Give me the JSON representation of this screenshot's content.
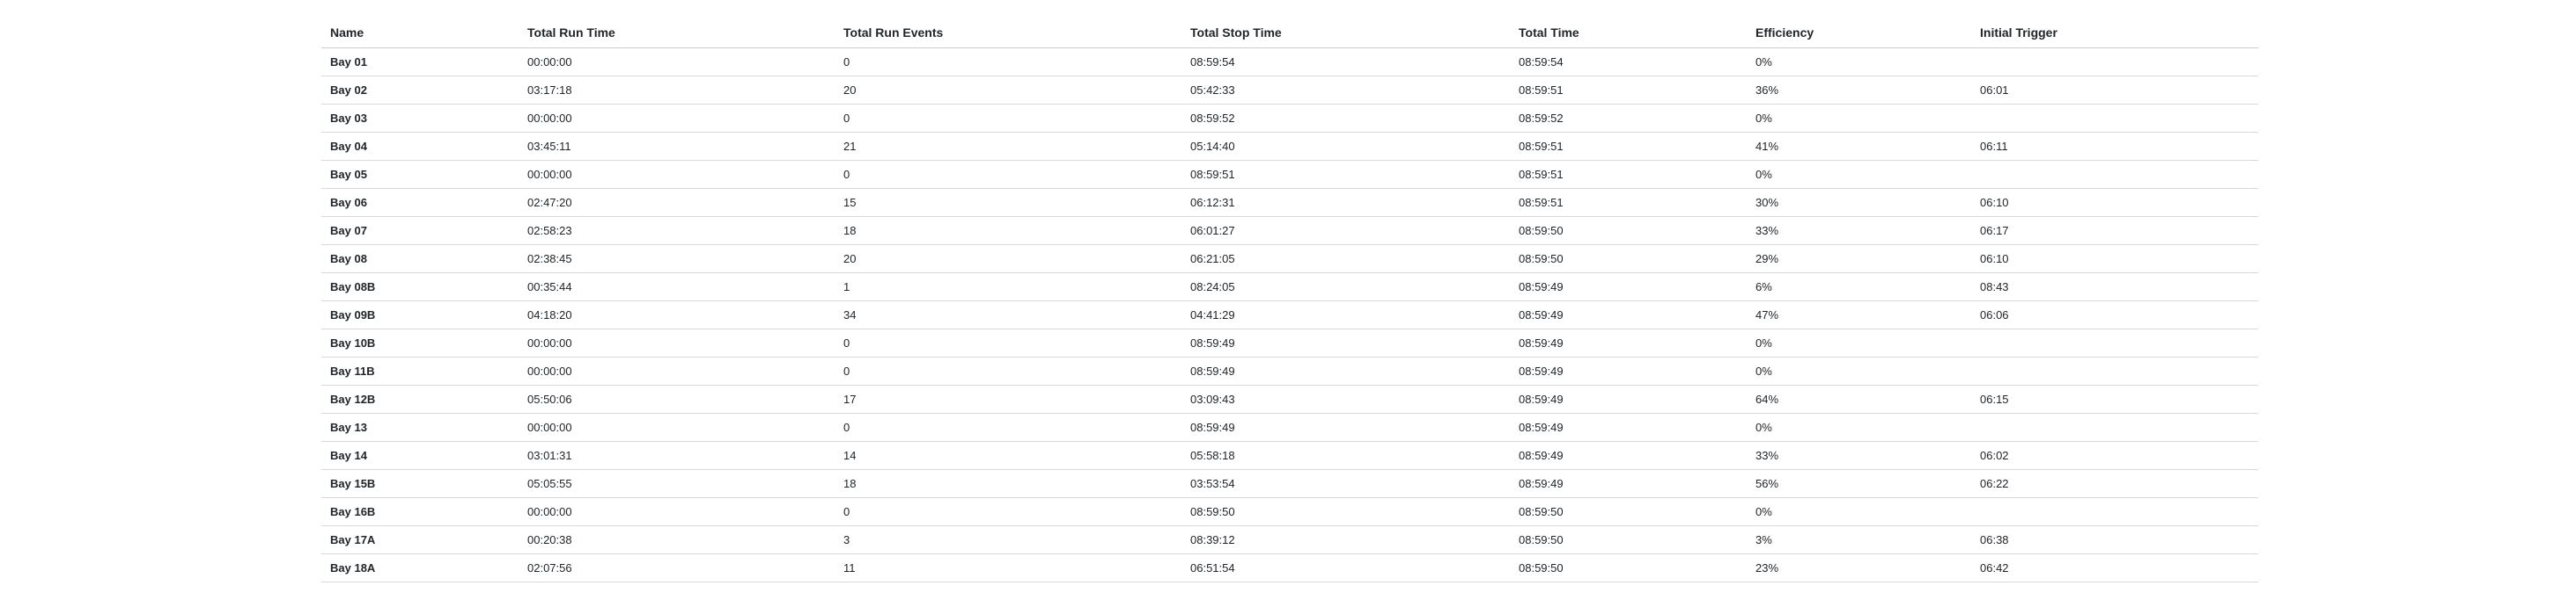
{
  "table": {
    "headers": {
      "name": "Name",
      "total_run_time": "Total Run Time",
      "total_run_events": "Total Run Events",
      "total_stop_time": "Total Stop Time",
      "total_time": "Total Time",
      "efficiency": "Efficiency",
      "initial_trigger": "Initial Trigger"
    },
    "rows": [
      {
        "name": "Bay 01",
        "run_time": "00:00:00",
        "run_events": "0",
        "stop_time": "08:59:54",
        "total_time": "08:59:54",
        "efficiency": "0%",
        "initial_trigger": ""
      },
      {
        "name": "Bay 02",
        "run_time": "03:17:18",
        "run_events": "20",
        "stop_time": "05:42:33",
        "total_time": "08:59:51",
        "efficiency": "36%",
        "initial_trigger": "06:01"
      },
      {
        "name": "Bay 03",
        "run_time": "00:00:00",
        "run_events": "0",
        "stop_time": "08:59:52",
        "total_time": "08:59:52",
        "efficiency": "0%",
        "initial_trigger": ""
      },
      {
        "name": "Bay 04",
        "run_time": "03:45:11",
        "run_events": "21",
        "stop_time": "05:14:40",
        "total_time": "08:59:51",
        "efficiency": "41%",
        "initial_trigger": "06:11"
      },
      {
        "name": "Bay 05",
        "run_time": "00:00:00",
        "run_events": "0",
        "stop_time": "08:59:51",
        "total_time": "08:59:51",
        "efficiency": "0%",
        "initial_trigger": ""
      },
      {
        "name": "Bay 06",
        "run_time": "02:47:20",
        "run_events": "15",
        "stop_time": "06:12:31",
        "total_time": "08:59:51",
        "efficiency": "30%",
        "initial_trigger": "06:10"
      },
      {
        "name": "Bay 07",
        "run_time": "02:58:23",
        "run_events": "18",
        "stop_time": "06:01:27",
        "total_time": "08:59:50",
        "efficiency": "33%",
        "initial_trigger": "06:17"
      },
      {
        "name": "Bay 08",
        "run_time": "02:38:45",
        "run_events": "20",
        "stop_time": "06:21:05",
        "total_time": "08:59:50",
        "efficiency": "29%",
        "initial_trigger": "06:10"
      },
      {
        "name": "Bay 08B",
        "run_time": "00:35:44",
        "run_events": "1",
        "stop_time": "08:24:05",
        "total_time": "08:59:49",
        "efficiency": "6%",
        "initial_trigger": "08:43"
      },
      {
        "name": "Bay 09B",
        "run_time": "04:18:20",
        "run_events": "34",
        "stop_time": "04:41:29",
        "total_time": "08:59:49",
        "efficiency": "47%",
        "initial_trigger": "06:06"
      },
      {
        "name": "Bay 10B",
        "run_time": "00:00:00",
        "run_events": "0",
        "stop_time": "08:59:49",
        "total_time": "08:59:49",
        "efficiency": "0%",
        "initial_trigger": ""
      },
      {
        "name": "Bay 11B",
        "run_time": "00:00:00",
        "run_events": "0",
        "stop_time": "08:59:49",
        "total_time": "08:59:49",
        "efficiency": "0%",
        "initial_trigger": ""
      },
      {
        "name": "Bay 12B",
        "run_time": "05:50:06",
        "run_events": "17",
        "stop_time": "03:09:43",
        "total_time": "08:59:49",
        "efficiency": "64%",
        "initial_trigger": "06:15"
      },
      {
        "name": "Bay 13",
        "run_time": "00:00:00",
        "run_events": "0",
        "stop_time": "08:59:49",
        "total_time": "08:59:49",
        "efficiency": "0%",
        "initial_trigger": ""
      },
      {
        "name": "Bay 14",
        "run_time": "03:01:31",
        "run_events": "14",
        "stop_time": "05:58:18",
        "total_time": "08:59:49",
        "efficiency": "33%",
        "initial_trigger": "06:02"
      },
      {
        "name": "Bay 15B",
        "run_time": "05:05:55",
        "run_events": "18",
        "stop_time": "03:53:54",
        "total_time": "08:59:49",
        "efficiency": "56%",
        "initial_trigger": "06:22"
      },
      {
        "name": "Bay 16B",
        "run_time": "00:00:00",
        "run_events": "0",
        "stop_time": "08:59:50",
        "total_time": "08:59:50",
        "efficiency": "0%",
        "initial_trigger": ""
      },
      {
        "name": "Bay 17A",
        "run_time": "00:20:38",
        "run_events": "3",
        "stop_time": "08:39:12",
        "total_time": "08:59:50",
        "efficiency": "3%",
        "initial_trigger": "06:38"
      },
      {
        "name": "Bay 18A",
        "run_time": "02:07:56",
        "run_events": "11",
        "stop_time": "06:51:54",
        "total_time": "08:59:50",
        "efficiency": "23%",
        "initial_trigger": "06:42"
      }
    ]
  }
}
